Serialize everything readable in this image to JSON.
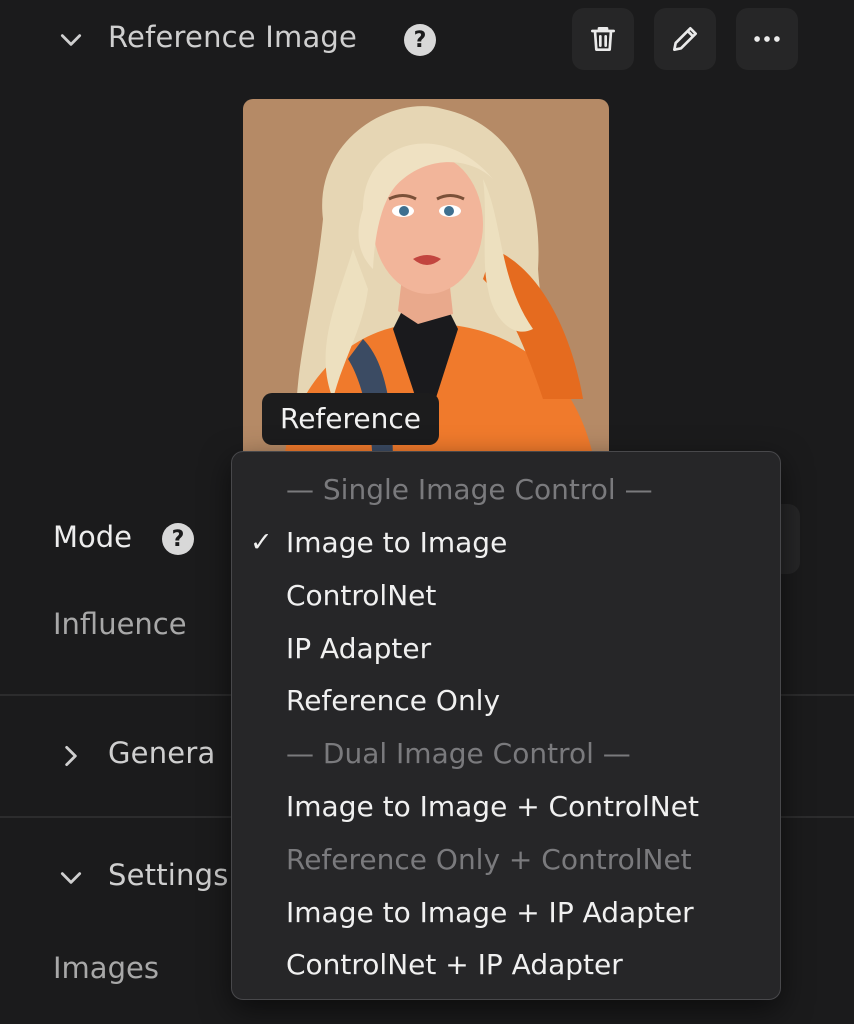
{
  "reference_section": {
    "title": "Reference Image",
    "image_tag": "Reference"
  },
  "mode": {
    "label": "Mode"
  },
  "influence": {
    "label": "Influence"
  },
  "general_section": {
    "title": "Genera"
  },
  "settings_section": {
    "title": "Settings"
  },
  "images": {
    "label": "Images"
  },
  "mode_menu": {
    "header_single": "— Single Image Control —",
    "item_img2img": "Image to Image",
    "item_controlnet": "ControlNet",
    "item_ip_adapter": "IP Adapter",
    "item_reference_only": "Reference Only",
    "header_dual": "— Dual Image Control —",
    "item_img2img_controlnet": "Image to Image + ControlNet",
    "item_reference_controlnet": "Reference Only + ControlNet",
    "item_img2img_ip_adapter": "Image to Image + IP Adapter",
    "item_controlnet_ip_adapter": "ControlNet + IP Adapter",
    "selected": "Image to Image"
  },
  "icons": {
    "help": "question-circle-icon",
    "delete": "trash-icon",
    "edit": "pencil-icon",
    "more": "ellipsis-icon",
    "check": "checkmark-icon"
  },
  "colors": {
    "background": "#1b1b1c",
    "menu_background": "#262628",
    "text": "#f0f0f0",
    "disabled_text": "#7a7a7d"
  }
}
